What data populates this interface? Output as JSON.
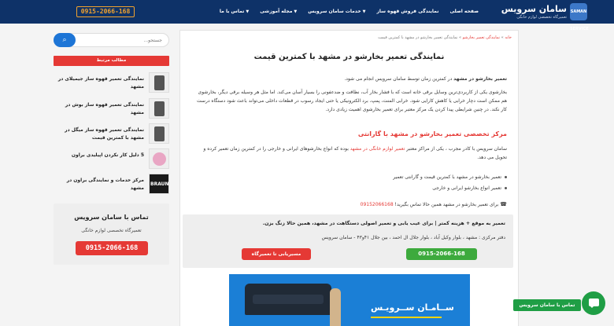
{
  "header": {
    "logo_badge": "SAMAN SERVICE",
    "logo_title": "سامان سرویس",
    "logo_subtitle": "تعمیرگاه تخصصی لوازم خانگی",
    "menu": [
      {
        "label": "صفحه اصلی",
        "has_dropdown": false
      },
      {
        "label": "نمایندگی فروش قهوه ساز",
        "has_dropdown": false
      },
      {
        "label": "خدمات سامان سرویس",
        "has_dropdown": true
      },
      {
        "label": "مجله آموزشی",
        "has_dropdown": true
      },
      {
        "label": "تماس با ما",
        "has_dropdown": true
      }
    ],
    "phone": "0915-2066-168"
  },
  "breadcrumb": {
    "home": "خانه",
    "separator": "»",
    "category": "نمایندگی تعمیر بخارشو",
    "current": "نمایندگی تعمیر بخارشو در مشهد با کمترین قیمت"
  },
  "article": {
    "title": "نمایندگی تعمیر بخارشو در مشهد با کمترین قیمت",
    "intro_bold": "تعمیر بخارشو در مشهد",
    "intro_rest": " در کمترین زمان توسط سامان سرویس انجام می شود.",
    "para1": "بخارشوی یکی از کاربردی‌ترین وسایل برقی خانه است که با فشار بخار آب، نظافت و ضدعفونی را بسیار آسان می‌کند. اما مثل هر وسیله برقی دیگر، بخارشوی هم ممکن است دچار خرابی یا کاهش کارایی شود. خرابی المنت، پمپ، برد الکترونیکی یا حتی ایجاد رسوب در قطعات داخلی می‌تواند باعث شود دستگاه درست کار نکند. در چنین شرایطی پیدا کردن یک مرکز معتبر برای تعمیر بخارشوی اهمیت زیادی دارد.",
    "h2": "مرکز تخصصی تعمیر بخارشو در مشهد با گارانتی",
    "para2_a": "سامان سرویس با کادر مجرب ، یکی از مراکز معتبر ",
    "para2_link1": "تعمیر لوازم خانگی",
    "para2_b": " ",
    "para2_link2": "در مشهد",
    "para2_c": " بوده که انواع بخارشوهای ایرانی و خارجی را در کمترین زمان تعمیر کرده و تحویل می دهد.",
    "bullets": [
      "تعمیر بخارشو در مشهد با کمترین قیمت و گارانتی تعمیر",
      "تعمیر انواع بخارشو ایرانی و خارجی"
    ],
    "call_prefix": "برای تعمیر بخارشو در مشهد همین حالا تماس بگیرید! ",
    "call_number": "09152066168"
  },
  "cta": {
    "title": "تعمیر به موقع + هزینه کمتر | برای عیب یابی و تعمیر اصولی دستگاهت در مشهد، همین حالا زنگ بزن.",
    "address": "دفتر مرکزی : مشهد ، بلوار وکیل آباد ، بلوار جلال ال احمد ، بین جلال ۴۱و۴۳ - سامان سرویس",
    "phone_button": "0915-2066-168",
    "route_button": "مسیریابی تا تعمیرگاه"
  },
  "banner": {
    "brand_text": "ســامـان ســرویـس"
  },
  "sidebar": {
    "search_placeholder": "جستجو...",
    "related_heading": "مطالب مرتبط",
    "related": [
      {
        "title": "نمایندگی تعمیر قهوه ساز جیمیلای در مشهد",
        "thumb": "espresso-machine"
      },
      {
        "title": "نمایندگی تعمیر قهوه ساز بوش در مشهد",
        "thumb": "coffee-maker"
      },
      {
        "title": "نمایندگی تعمیر قهوه ساز میگل در مشهد با کمترین قیمت",
        "thumb": "coffee-maker"
      },
      {
        "title": "5 دلیل کار نکردن اپیلیدی براون",
        "thumb": "epilator"
      },
      {
        "title": "مرکز خدمات و نمایندگی براون در مشهد",
        "thumb": "braun-logo"
      }
    ],
    "contact": {
      "title": "تماس با سامان سرویس",
      "subtitle": "تعمیرگاه تخصصی لوازم خانگی",
      "phone": "0915-2066-168"
    }
  },
  "chat": {
    "label": "تماس با سامان سرویس"
  },
  "colors": {
    "header_bg": "#0e3268",
    "accent_red": "#e53935",
    "accent_green": "#3daa3d",
    "accent_blue": "#1d75d6",
    "phone_orange": "#f2a32e"
  },
  "icons": {
    "search": "search-icon",
    "phone": "phone-icon",
    "chat": "chat-icon",
    "caret": "chevron-down-icon"
  }
}
